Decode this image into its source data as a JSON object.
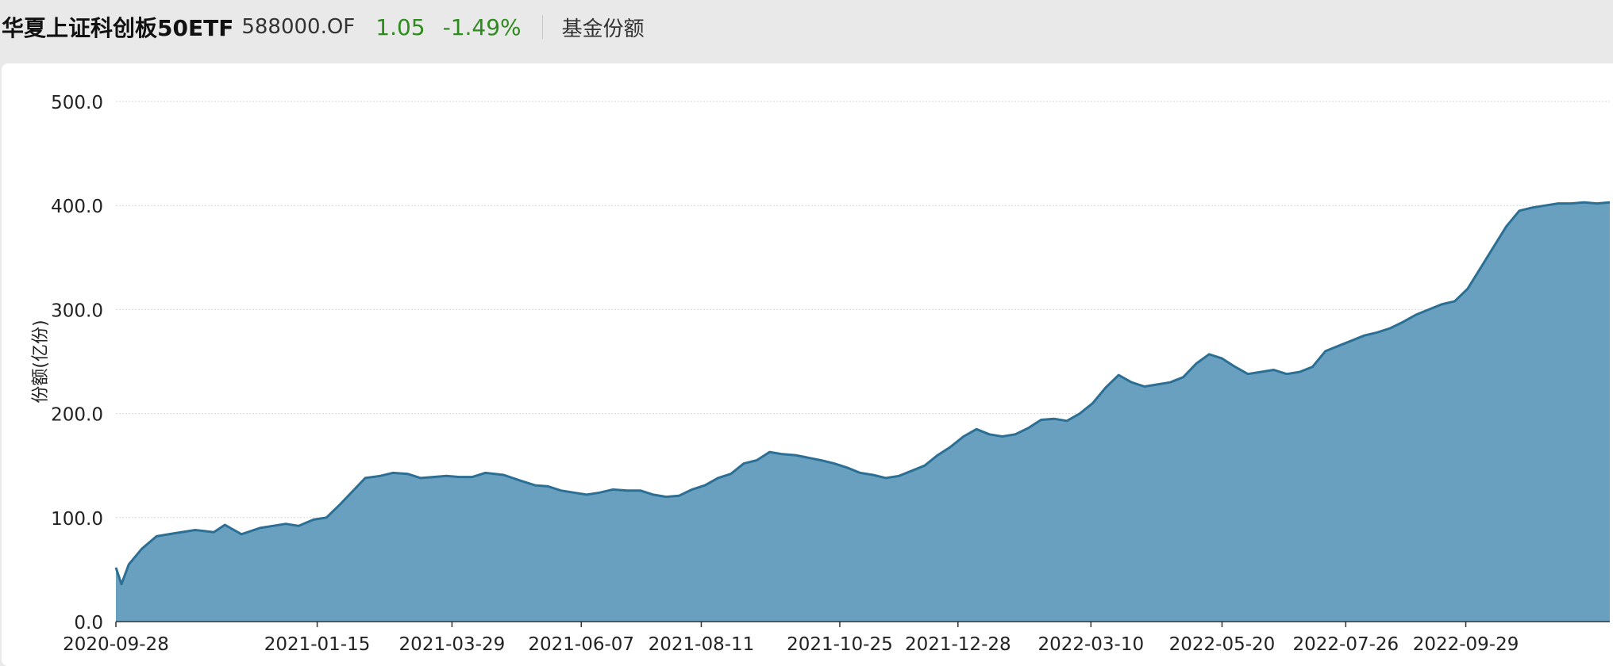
{
  "header": {
    "fund_name": "华夏上证科创板50ETF",
    "fund_code": "588000.OF",
    "price": "1.05",
    "change": "-1.49%",
    "tab_label": "基金份额",
    "price_color": "#2e8b1e"
  },
  "chart_data": {
    "type": "area",
    "title": "",
    "xlabel": "",
    "ylabel": "份额(亿份)",
    "ylim": [
      0,
      500
    ],
    "yticks": [
      0,
      100,
      200,
      300,
      400,
      500
    ],
    "ytick_labels": [
      "0.0",
      "100.0",
      "200.0",
      "300.0",
      "400.0",
      "500.0"
    ],
    "xlim": [
      "2020-09-28",
      "2022-12-16"
    ],
    "xticks": [
      "2020-09-28",
      "2021-01-15",
      "2021-03-29",
      "2021-06-07",
      "2021-08-11",
      "2021-10-25",
      "2021-12-28",
      "2022-03-10",
      "2022-05-20",
      "2022-07-26",
      "2022-09-29"
    ],
    "grid": true,
    "fill_color": "#6aa0bf",
    "line_color": "#2c6f94",
    "series": [
      {
        "x": [
          "2020-09-28",
          "2020-10-01",
          "2020-10-05",
          "2020-10-12",
          "2020-10-20",
          "2020-10-30",
          "2020-11-10",
          "2020-11-20",
          "2020-11-26",
          "2020-12-05",
          "2020-12-15",
          "2020-12-22",
          "2020-12-29",
          "2021-01-05",
          "2021-01-13",
          "2021-01-20",
          "2021-01-27",
          "2021-02-03",
          "2021-02-10",
          "2021-02-18",
          "2021-02-25",
          "2021-03-05",
          "2021-03-12",
          "2021-03-19",
          "2021-03-26",
          "2021-04-02",
          "2021-04-09",
          "2021-04-16",
          "2021-04-26",
          "2021-05-06",
          "2021-05-13",
          "2021-05-20",
          "2021-05-27",
          "2021-06-03",
          "2021-06-10",
          "2021-06-17",
          "2021-06-24",
          "2021-07-02",
          "2021-07-09",
          "2021-07-16",
          "2021-07-23",
          "2021-07-30",
          "2021-08-06",
          "2021-08-13",
          "2021-08-20",
          "2021-08-27",
          "2021-09-03",
          "2021-09-10",
          "2021-09-17",
          "2021-09-24",
          "2021-10-01",
          "2021-10-15",
          "2021-10-22",
          "2021-10-29",
          "2021-11-05",
          "2021-11-12",
          "2021-11-19",
          "2021-11-26",
          "2021-12-03",
          "2021-12-10",
          "2021-12-17",
          "2021-12-24",
          "2021-12-31",
          "2022-01-07",
          "2022-01-14",
          "2022-01-21",
          "2022-01-28",
          "2022-02-04",
          "2022-02-11",
          "2022-02-18",
          "2022-02-25",
          "2022-03-04",
          "2022-03-11",
          "2022-03-18",
          "2022-03-25",
          "2022-04-01",
          "2022-04-08",
          "2022-04-15",
          "2022-04-22",
          "2022-04-29",
          "2022-05-06",
          "2022-05-13",
          "2022-05-20",
          "2022-05-27",
          "2022-06-03",
          "2022-06-10",
          "2022-06-17",
          "2022-06-24",
          "2022-07-01",
          "2022-07-08",
          "2022-07-15",
          "2022-07-22",
          "2022-07-29",
          "2022-08-05",
          "2022-08-12",
          "2022-08-19",
          "2022-08-26",
          "2022-09-02",
          "2022-09-09",
          "2022-09-16",
          "2022-09-23",
          "2022-09-30",
          "2022-10-07",
          "2022-10-14",
          "2022-10-21",
          "2022-10-28",
          "2022-11-04",
          "2022-11-11",
          "2022-11-18",
          "2022-11-25",
          "2022-12-02",
          "2022-12-09",
          "2022-12-16"
        ],
        "values": [
          52,
          36,
          55,
          70,
          82,
          85,
          88,
          86,
          93,
          84,
          90,
          92,
          94,
          92,
          98,
          100,
          112,
          125,
          138,
          140,
          143,
          142,
          138,
          139,
          140,
          139,
          139,
          143,
          141,
          135,
          131,
          130,
          126,
          124,
          122,
          124,
          127,
          126,
          126,
          122,
          120,
          121,
          127,
          131,
          138,
          142,
          152,
          155,
          163,
          161,
          160,
          155,
          152,
          148,
          143,
          141,
          138,
          140,
          145,
          150,
          160,
          168,
          178,
          185,
          180,
          178,
          180,
          186,
          194,
          195,
          193,
          200,
          210,
          225,
          237,
          230,
          226,
          228,
          230,
          235,
          248,
          257,
          253,
          245,
          238,
          240,
          242,
          238,
          240,
          245,
          260,
          265,
          270,
          275,
          278,
          282,
          288,
          295,
          300,
          305,
          308,
          320,
          340,
          360,
          380,
          395,
          398,
          400,
          402,
          402,
          403,
          402,
          403
        ]
      }
    ]
  }
}
